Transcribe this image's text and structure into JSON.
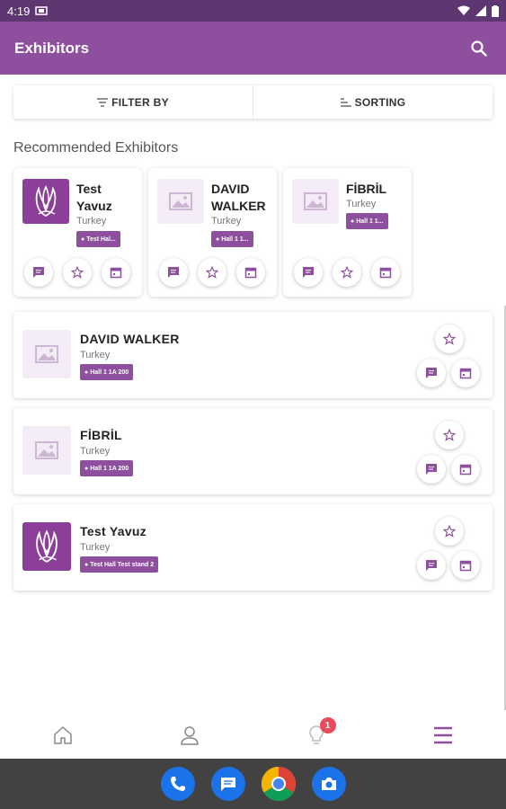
{
  "status": {
    "time": "4:19"
  },
  "appbar": {
    "title": "Exhibitors"
  },
  "filters": {
    "filter_label": "FILTER BY",
    "sort_label": "SORTING"
  },
  "recommended": {
    "title": "Recommended Exhibitors",
    "items": [
      {
        "name": "Test Yavuz",
        "country": "Turkey",
        "location": "Test Hal...",
        "image": "logo"
      },
      {
        "name": "DAVID WALKER",
        "country": "Turkey",
        "location": "Hall 1 1...",
        "image": "placeholder"
      },
      {
        "name": "FİBRİL",
        "country": "Turkey",
        "location": "Hall 1 1...",
        "image": "placeholder"
      }
    ]
  },
  "exhibitors": [
    {
      "name": "DAVID WALKER",
      "country": "Turkey",
      "location": "Hall 1 1A 200",
      "image": "placeholder"
    },
    {
      "name": "FİBRİL",
      "country": "Turkey",
      "location": "Hall 1 1A 200",
      "image": "placeholder"
    },
    {
      "name": "Test Yavuz",
      "country": "Turkey",
      "location": "Test Hall Test stand 2",
      "image": "logo"
    }
  ],
  "bottom_nav": {
    "items": [
      "home-icon",
      "profile-icon",
      "lightbulb-icon",
      "menu-icon"
    ],
    "notification_count": "1",
    "active": "menu-icon"
  },
  "dock": {
    "apps": [
      "phone-icon",
      "messages-icon",
      "chrome-icon",
      "camera-icon"
    ]
  },
  "colors": {
    "primary": "#8e4f9f",
    "status_bar": "#5e3672",
    "badge": "#e94b5b",
    "placeholder_bg": "#f3ebf5"
  }
}
